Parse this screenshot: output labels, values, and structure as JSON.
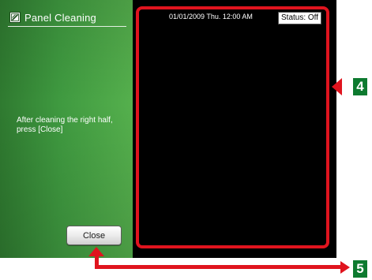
{
  "screen": {
    "title": "Panel Cleaning",
    "title_icon": "panel-cleaning-icon",
    "instructions": {
      "line1": "After cleaning the right half,",
      "line2": "press [Close]"
    },
    "close_button_label": "Close",
    "datetime": "01/01/2009 Thu. 12:00 AM",
    "status": "Status: Off"
  },
  "annotations": {
    "callout_4": "4",
    "callout_5": "5"
  },
  "colors": {
    "panel_green": "#3f9a40",
    "screen_black": "#000000",
    "highlight_red": "#e0141e",
    "callout_green": "#0d7a2f"
  }
}
